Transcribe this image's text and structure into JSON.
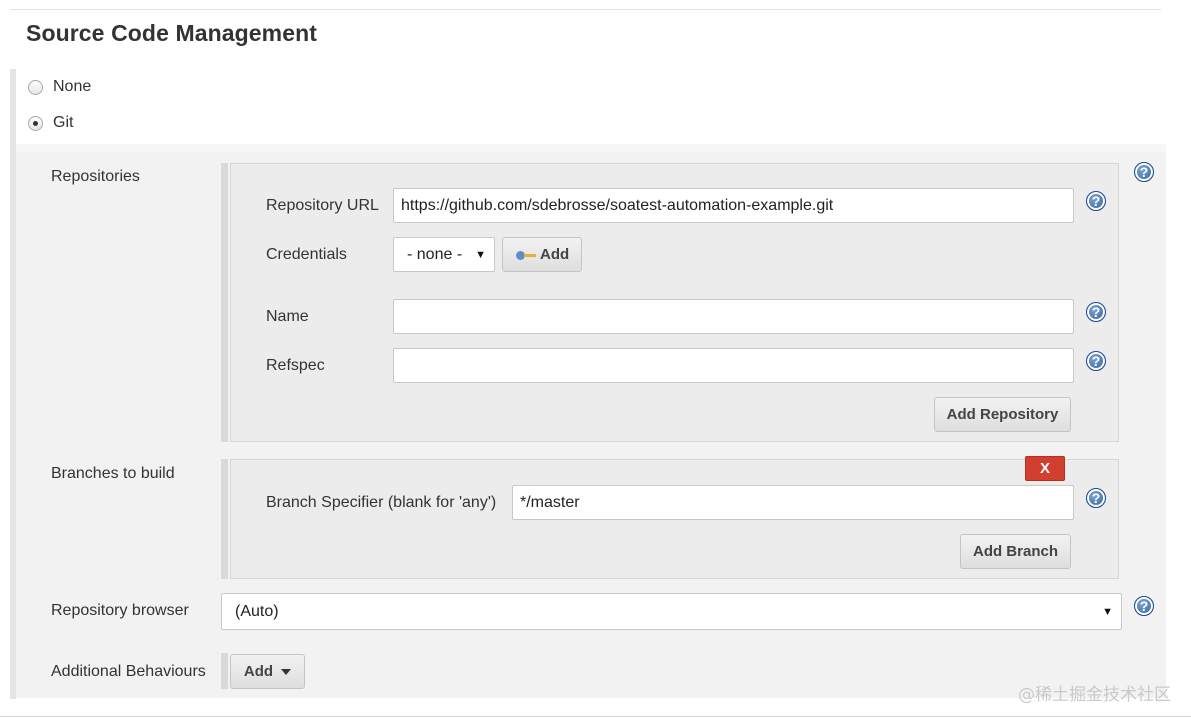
{
  "section": {
    "title": "Source Code Management"
  },
  "scm_options": [
    {
      "label": "None",
      "selected": false
    },
    {
      "label": "Git",
      "selected": true
    }
  ],
  "repositories": {
    "label": "Repositories",
    "url_label": "Repository URL",
    "url_value": "https://github.com/sdebrosse/soatest-automation-example.git",
    "credentials_label": "Credentials",
    "credentials_value": "- none -",
    "credentials_add_label": "Add",
    "name_label": "Name",
    "name_value": "",
    "refspec_label": "Refspec",
    "refspec_value": "",
    "add_repository_label": "Add Repository"
  },
  "branches": {
    "label": "Branches to build",
    "delete_label": "X",
    "specifier_label": "Branch Specifier (blank for 'any')",
    "specifier_value": "*/master",
    "add_branch_label": "Add Branch"
  },
  "repository_browser": {
    "label": "Repository browser",
    "value": "(Auto)"
  },
  "additional_behaviours": {
    "label": "Additional Behaviours",
    "add_label": "Add"
  },
  "help": {
    "glyph": "?"
  },
  "watermark": "@稀土掘金技术社区",
  "colors": {
    "delete": "#d23f2f",
    "help": "#2a5a98"
  }
}
